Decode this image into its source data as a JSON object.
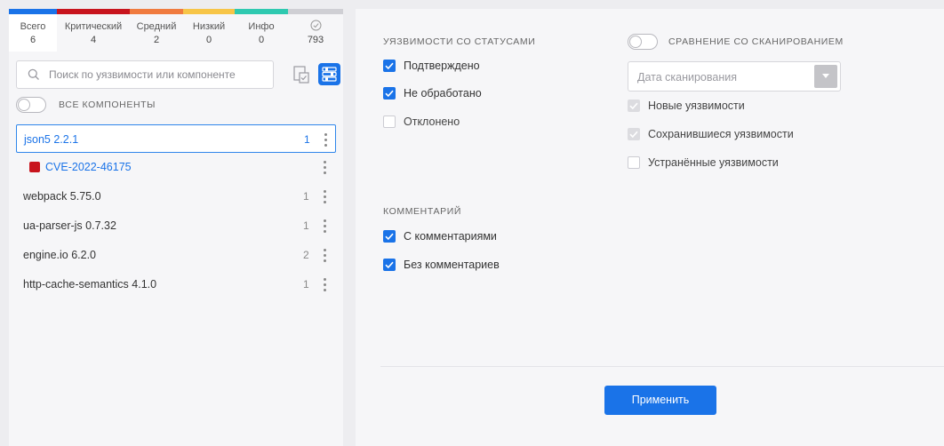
{
  "colors": {
    "accent": "#1a73e8",
    "critical": "#c8141d",
    "medium": "#f07b3f",
    "low": "#f7c548",
    "info": "#2ec9b0",
    "total": "#1a73e8",
    "ignored": "#cfcfd4"
  },
  "stats": [
    {
      "label": "Всего",
      "value": "6",
      "color": "#1a73e8"
    },
    {
      "label": "Критический",
      "value": "4",
      "color": "#c8141d"
    },
    {
      "label": "Средний",
      "value": "2",
      "color": "#f07b3f"
    },
    {
      "label": "Низкий",
      "value": "0",
      "color": "#f7c548"
    },
    {
      "label": "Инфо",
      "value": "0",
      "color": "#2ec9b0"
    },
    {
      "label": "",
      "icon": "shield-check-icon",
      "value": "793",
      "color": "#cfcfd4"
    }
  ],
  "search": {
    "placeholder": "Поиск по уязвимости или компоненте"
  },
  "all_components_label": "ВСЕ КОМПОНЕНТЫ",
  "components": [
    {
      "name": "json5 2.2.1",
      "count": "1",
      "selected": true
    },
    {
      "name": "CVE-2022-46175",
      "count": "",
      "cve": true,
      "severity": "critical"
    },
    {
      "name": "webpack 5.75.0",
      "count": "1"
    },
    {
      "name": "ua-parser-js 0.7.32",
      "count": "1"
    },
    {
      "name": "engine.io 6.2.0",
      "count": "2"
    },
    {
      "name": "http-cache-semantics 4.1.0",
      "count": "1"
    }
  ],
  "filters": {
    "statuses_title": "УЯЗВИМОСТИ СО СТАТУСАМИ",
    "statuses": [
      {
        "label": "Подтверждено",
        "checked": true
      },
      {
        "label": "Не обработано",
        "checked": true
      },
      {
        "label": "Отклонено",
        "checked": false
      }
    ],
    "comments_title": "КОММЕНТАРИЙ",
    "comments": [
      {
        "label": "С комментариями",
        "checked": true
      },
      {
        "label": "Без комментариев",
        "checked": true
      }
    ],
    "compare_label": "СРАВНЕНИЕ СО СКАНИРОВАНИЕМ",
    "compare_enabled": false,
    "scan_date_placeholder": "Дата сканирования",
    "compare_options": [
      {
        "label": "Новые уязвимости",
        "checked": true,
        "disabled": true
      },
      {
        "label": "Сохранившиеся уязвимости",
        "checked": true,
        "disabled": true
      },
      {
        "label": "Устранённые уязвимости",
        "checked": false,
        "disabled": false
      }
    ],
    "apply_label": "Применить"
  }
}
